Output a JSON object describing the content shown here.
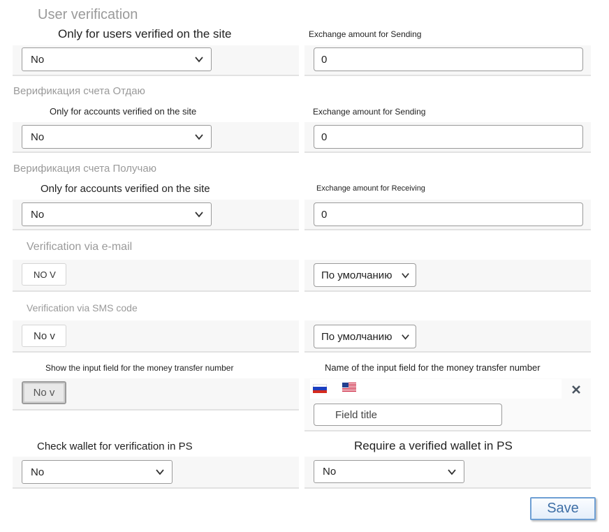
{
  "section_user": {
    "title": "User verification",
    "left_label": "Only for users verified on the site",
    "left_value": "No",
    "right_label": "Exchange amount for Sending",
    "right_value": "0"
  },
  "section_send": {
    "title": "Верификация счета Отдаю",
    "left_label": "Only for accounts verified on the site",
    "left_value": "No",
    "right_label": "Exchange amount for Sending",
    "right_value": "0"
  },
  "section_receive": {
    "title": "Верификация счета Получаю",
    "left_label": "Only for accounts verified on the site",
    "left_value": "No",
    "right_label": "Exchange amount for Receiving",
    "right_value": "0"
  },
  "section_email": {
    "title": "Verification via e-mail",
    "left_value": "NO V",
    "right_value": "По умолчанию"
  },
  "section_sms": {
    "title": "Verification via SMS code",
    "left_value": "No v",
    "right_value": "По умолчанию"
  },
  "section_transfer": {
    "left_label": "Show the input field for the money transfer number",
    "left_value": "No v",
    "right_label": "Name of the input field for the money transfer number",
    "field_placeholder": "Field title",
    "languages": [
      "ru-flag-icon",
      "us-flag-icon"
    ]
  },
  "section_wallet": {
    "left_label": "Check wallet for verification in PS",
    "left_value": "No",
    "right_label": "Require a verified wallet in PS",
    "right_value": "No"
  },
  "save_label": "Save",
  "colors": {
    "save_border": "#6e9fd4",
    "save_text": "#3e6fa6",
    "band": "#f7f7f7"
  }
}
